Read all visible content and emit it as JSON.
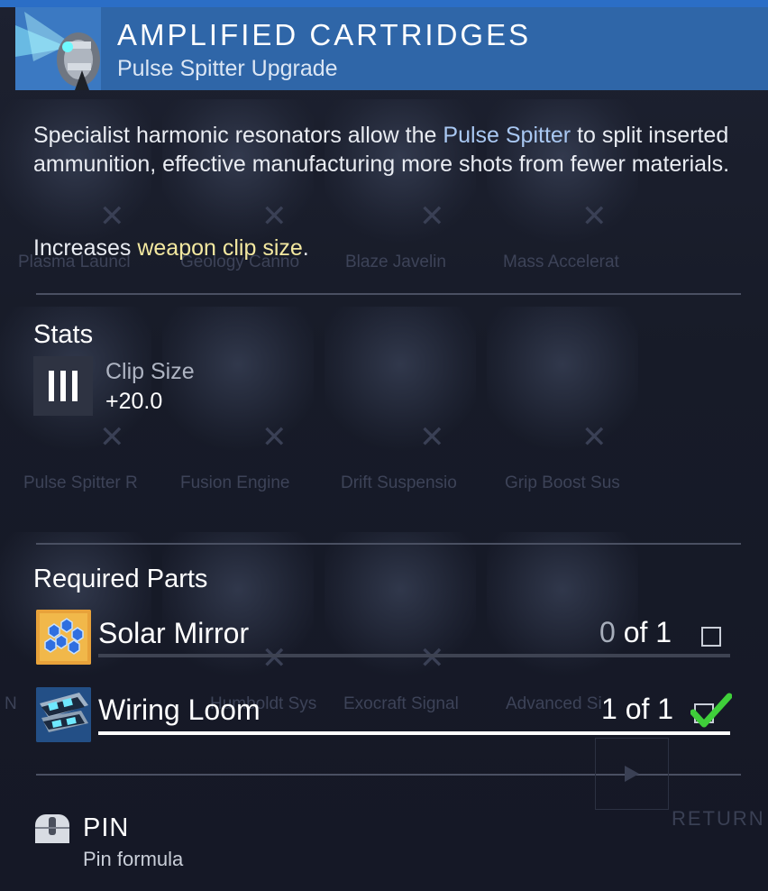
{
  "header": {
    "title": "AMPLIFIED CARTRIDGES",
    "subtitle": "Pulse Spitter Upgrade",
    "icon": "pulse-spitter-upgrade-icon"
  },
  "description": {
    "before": "Specialist harmonic resonators allow the ",
    "highlight": "Pulse Spitter",
    "after": " to split inserted ammunition, effective manufacturing more shots from fewer materials."
  },
  "effect": {
    "before": "Increases ",
    "highlight": "weapon clip size",
    "after": "."
  },
  "stats": {
    "title": "Stats",
    "items": [
      {
        "name": "Clip Size",
        "value": "+20.0",
        "icon": "clip-size-icon"
      }
    ]
  },
  "required_parts": {
    "title": "Required Parts",
    "items": [
      {
        "name": "Solar Mirror",
        "have": "0",
        "of_text": " of 1",
        "progress": 0.0,
        "complete": false,
        "icon": "solar-mirror-icon"
      },
      {
        "name": "Wiring Loom",
        "have": "1",
        "of_text": " of 1",
        "progress": 1.0,
        "complete": true,
        "icon": "wiring-loom-icon"
      }
    ]
  },
  "pin": {
    "label": "PIN",
    "sublabel": "Pin formula",
    "icon": "mouse-icon"
  },
  "return_label": "RETURN",
  "background_labels": [
    "Plasma Launcl",
    "Geology Canno",
    "Blaze Javelin",
    "Mass Accelerat",
    "Pulse Spitter R",
    "Fusion Engine",
    "Drift Suspensio",
    "Grip Boost Sus",
    "N",
    "Humboldt Sys",
    "Exocraft Signal",
    "Advanced Si"
  ],
  "colors": {
    "header_bg": "#2f66a8",
    "top_bar": "#2b6ec6",
    "highlight_blue": "#a9c8f2",
    "highlight_yellow": "#f3e8a0",
    "check_green": "#3fcf3a"
  }
}
